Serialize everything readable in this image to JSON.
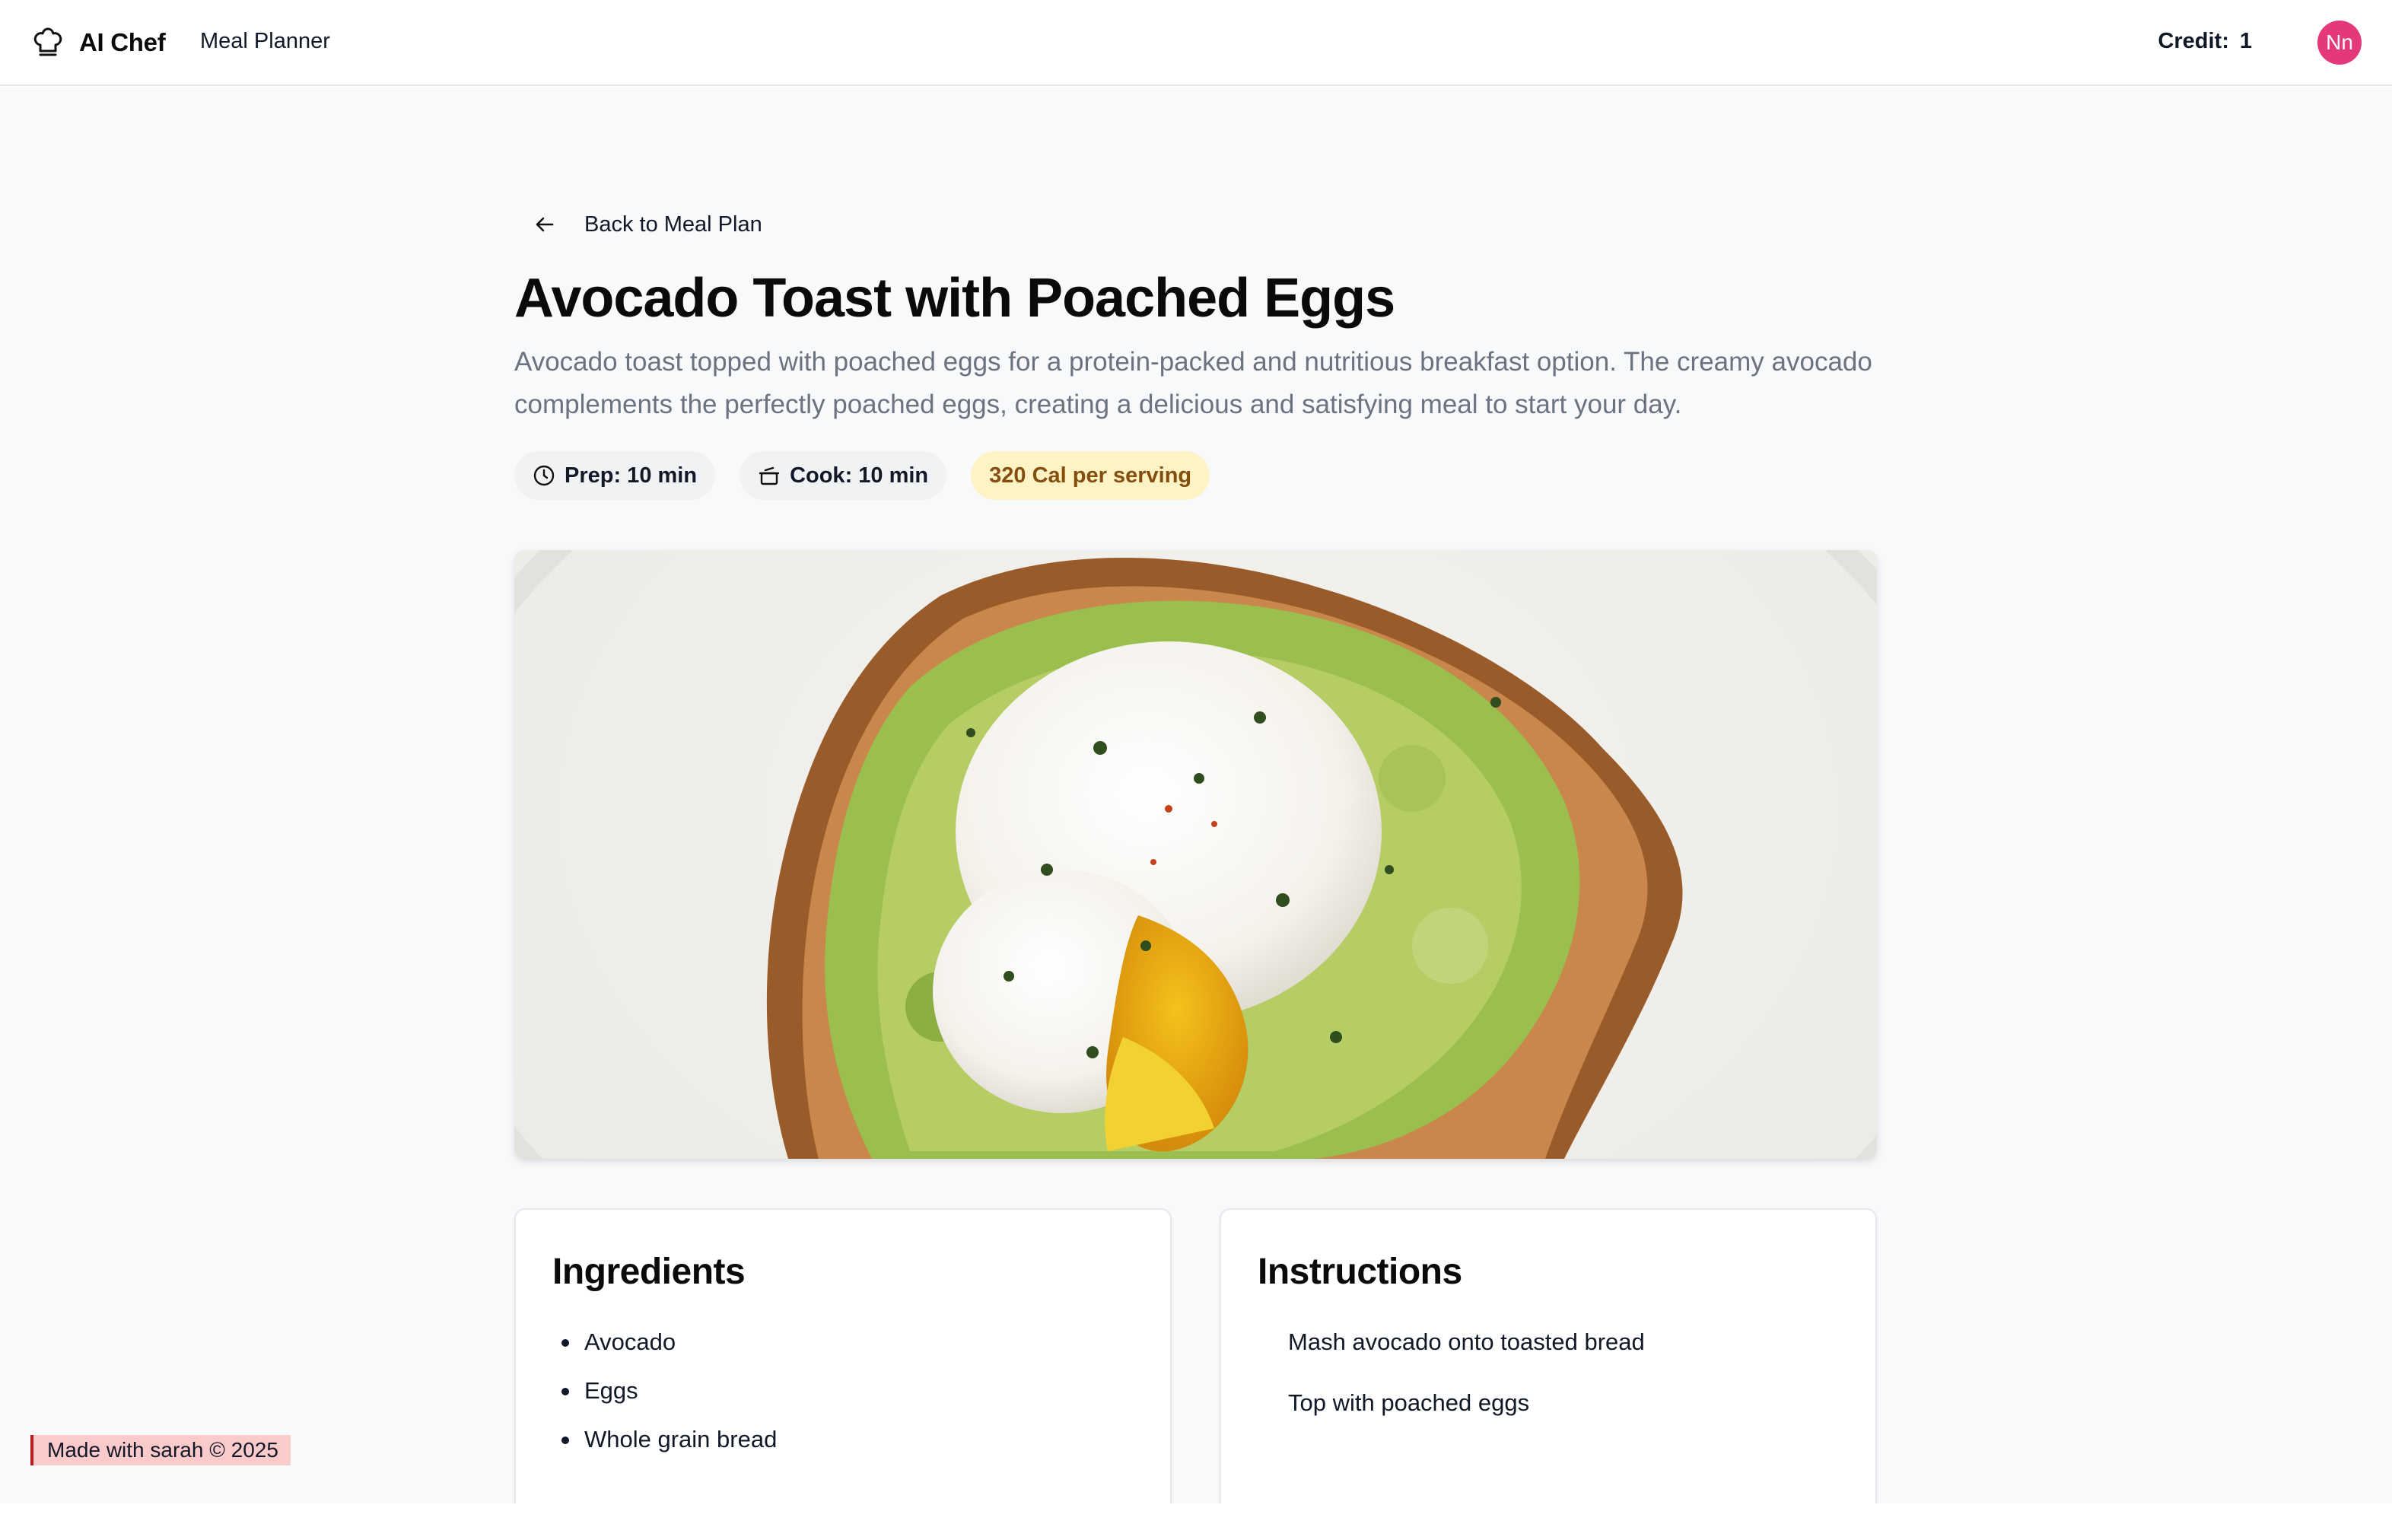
{
  "header": {
    "brand": "AI Chef",
    "brand_icon": "chef-hat-icon",
    "nav_link": "Meal Planner",
    "credit_label": "Credit:",
    "credit_value": "1",
    "avatar_initials": "Nn",
    "avatar_color": "#e5387a"
  },
  "recipe": {
    "back_label": "Back to Meal Plan",
    "back_icon": "arrow-left-icon",
    "title": "Avocado Toast with Poached Eggs",
    "description": "Avocado toast topped with poached eggs for a protein-packed and nutritious breakfast option. The creamy avocado complements the perfectly poached eggs, creating a delicious and satisfying meal to start your day.",
    "prep": "Prep: 10 min",
    "prep_icon": "clock-icon",
    "cook": "Cook: 10 min",
    "cook_icon": "cooking-pot-icon",
    "calories": "320 Cal per serving",
    "calories_color": "#fdf3c4"
  },
  "ingredients": {
    "heading": "Ingredients",
    "items": [
      "Avocado",
      "Eggs",
      "Whole grain bread"
    ]
  },
  "instructions": {
    "heading": "Instructions",
    "steps": [
      "Mash avocado onto toasted bread",
      "Top with poached eggs"
    ]
  },
  "footer": {
    "made_with": "Made with sarah © 2025"
  }
}
